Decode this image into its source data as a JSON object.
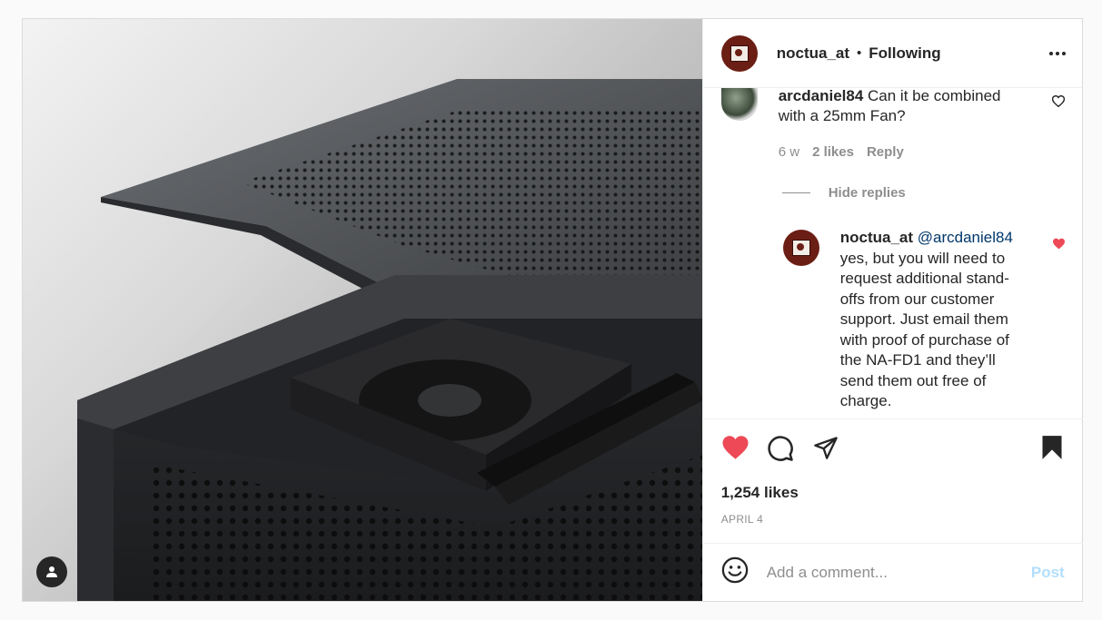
{
  "header": {
    "username": "noctua_at",
    "separator": "•",
    "follow_status": "Following"
  },
  "comments": [
    {
      "username": "arcdaniel84",
      "text": "Can it be combined with a 25mm Fan?",
      "time": "6 w",
      "likes": "2 likes",
      "reply_label": "Reply",
      "liked": false
    }
  ],
  "hide_replies_label": "Hide replies",
  "reply": {
    "username": "noctua_at",
    "mention": "@arcdaniel84",
    "text": "yes, but you will need to request additional stand-offs from our customer support. Just email them with proof of purchase of the NA-FD1 and they’ll send them out free of charge.",
    "liked": true
  },
  "post": {
    "likes": "1,254 likes",
    "date": "APRIL 4",
    "liked": true,
    "saved": true
  },
  "add_comment": {
    "placeholder": "Add a comment...",
    "post_label": "Post"
  },
  "colors": {
    "like_red": "#ed4956",
    "link_blue": "#00376b",
    "post_disabled": "#b2dffc",
    "muted_text": "#8e8e8e"
  },
  "icons": [
    "user-tag-icon",
    "more-icon",
    "heart-outline-icon",
    "heart-filled-icon",
    "comment-icon",
    "share-icon",
    "bookmark-filled-icon",
    "emoji-icon"
  ]
}
